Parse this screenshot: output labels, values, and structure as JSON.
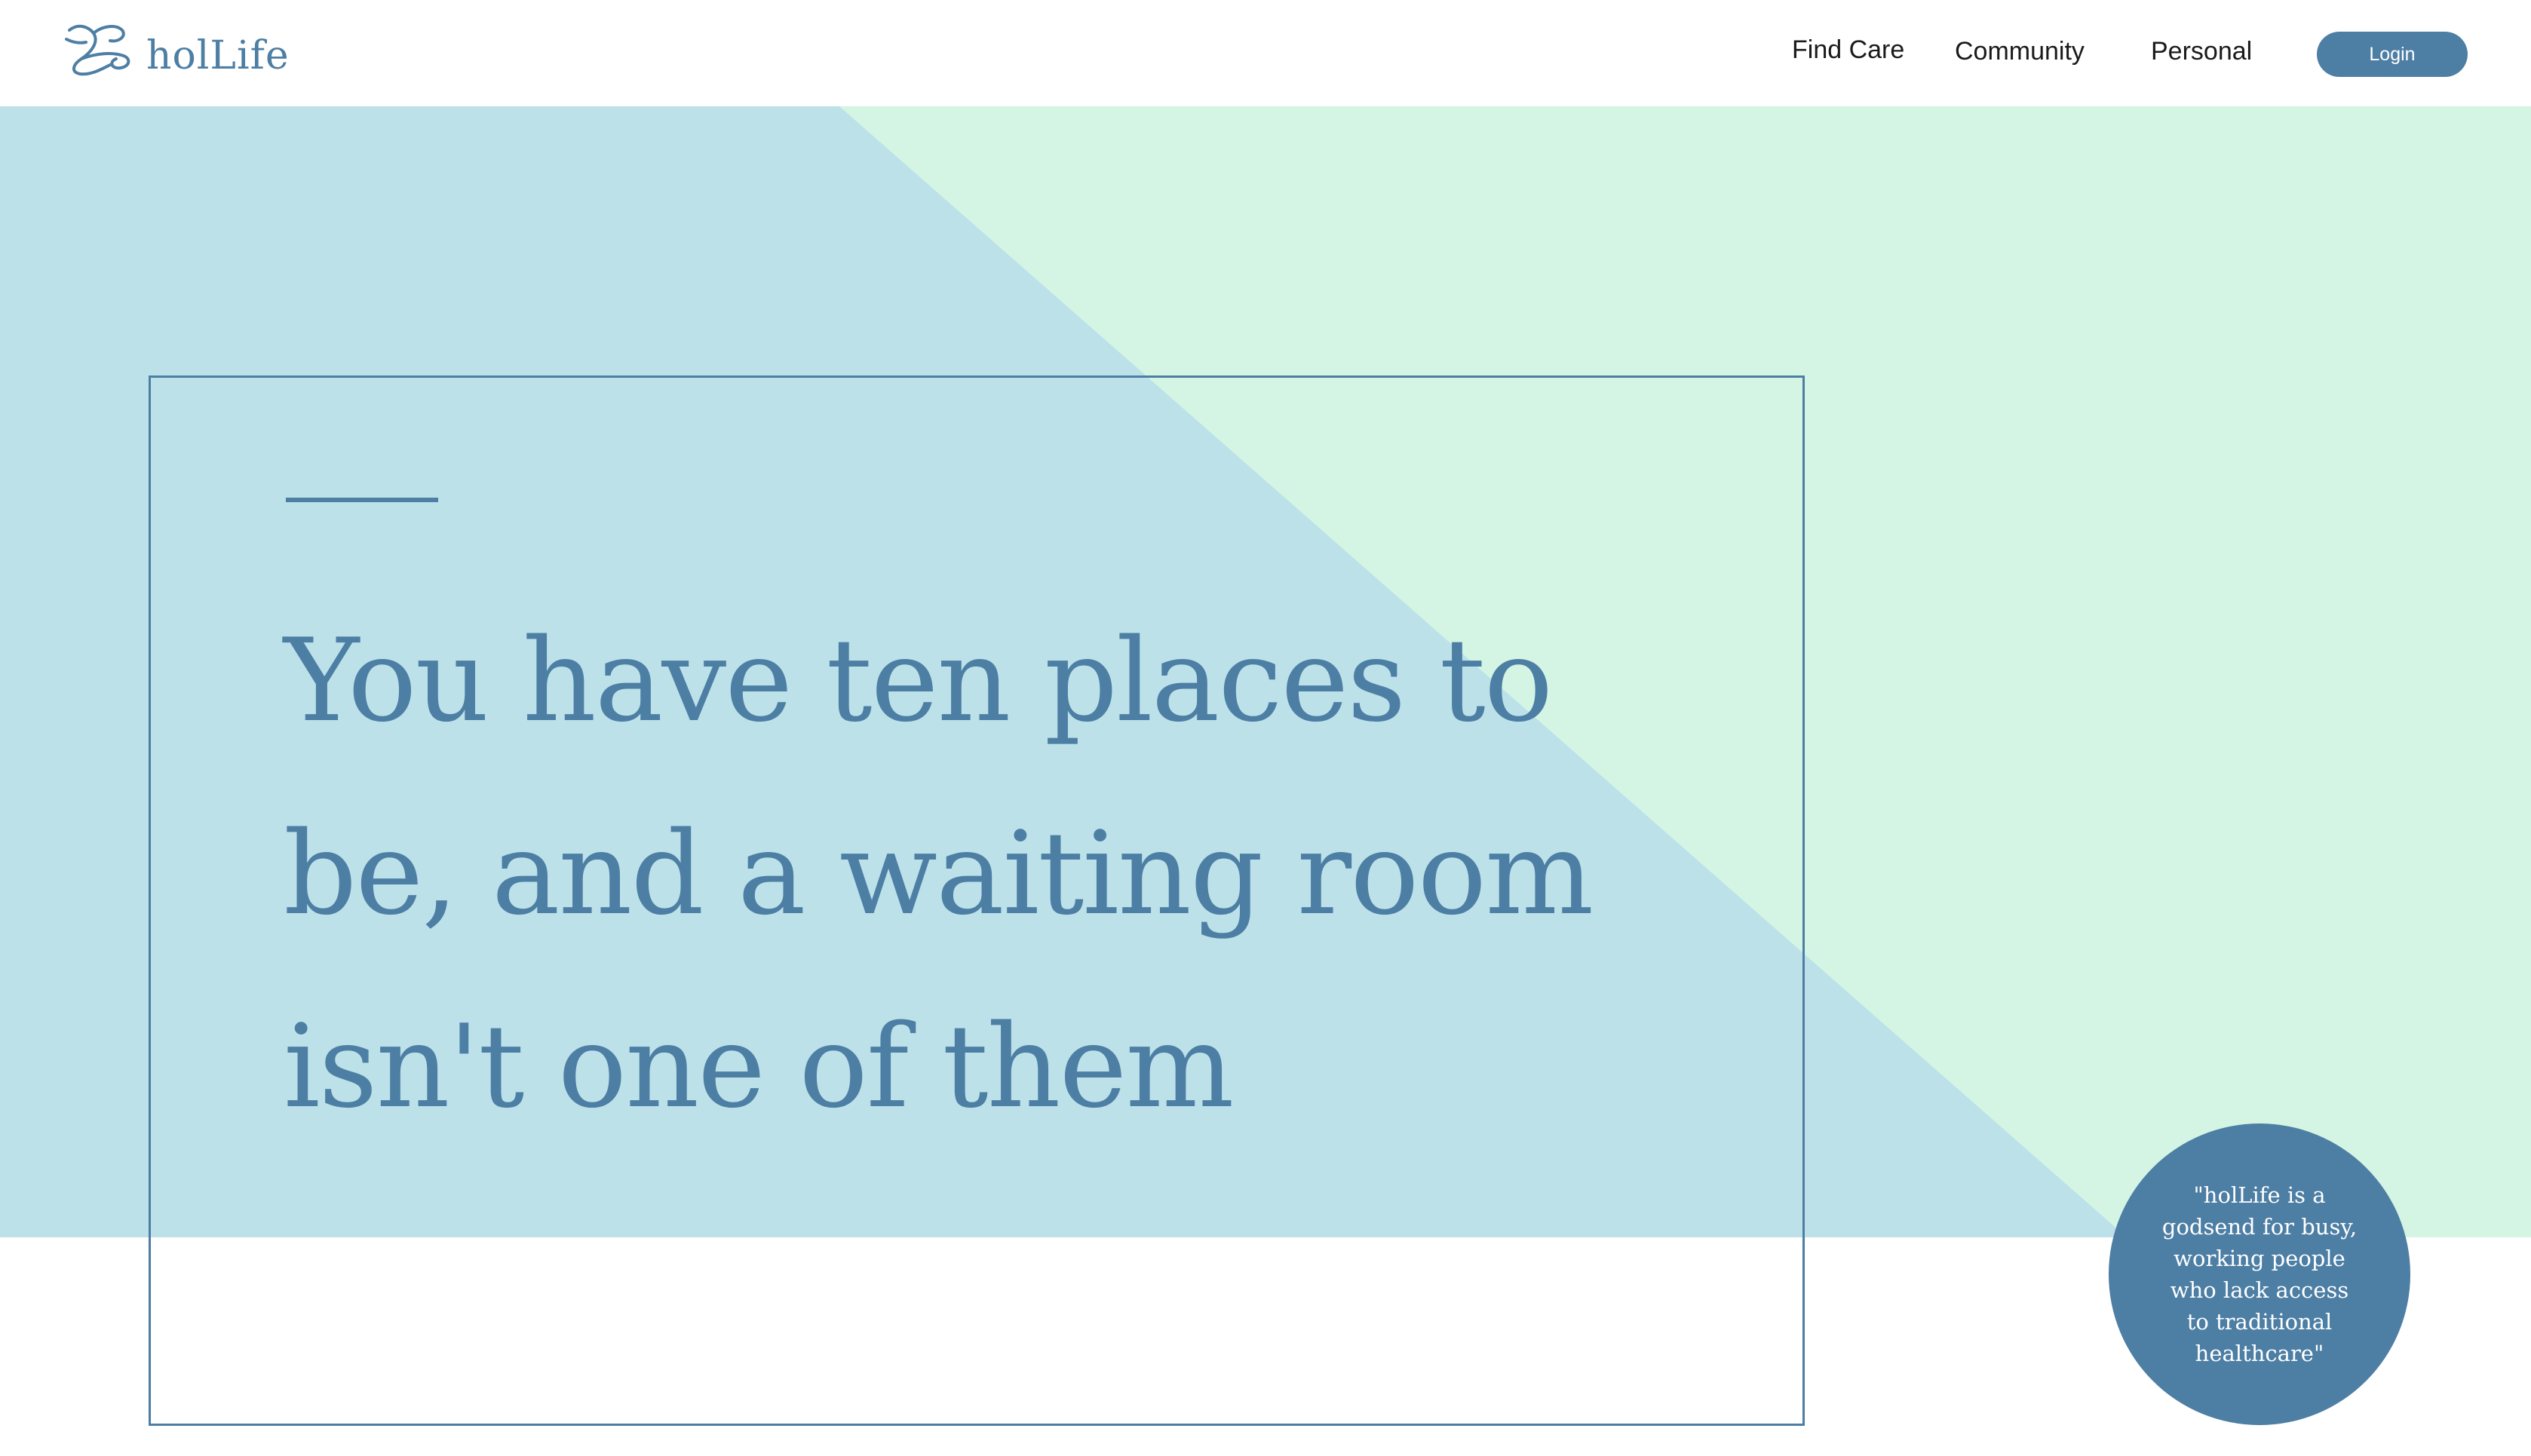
{
  "header": {
    "logo_text": "holLife",
    "logo_icon": "hollife-swirl-logo-icon",
    "nav": {
      "find_care": "Find Care",
      "community": "Community",
      "personal": "Personal"
    },
    "login_label": "Login"
  },
  "hero": {
    "headline_lines": [
      "You have ten places to",
      "be, and a waiting room",
      "isn't one of them"
    ],
    "quote": "\"holLife is a godsend for busy, working people who lack access to traditional healthcare\""
  },
  "colors": {
    "brand_blue": "#4d7ea4",
    "hero_blue": "#bce1e9",
    "hero_mint": "#d5f5e4",
    "white": "#ffffff"
  }
}
